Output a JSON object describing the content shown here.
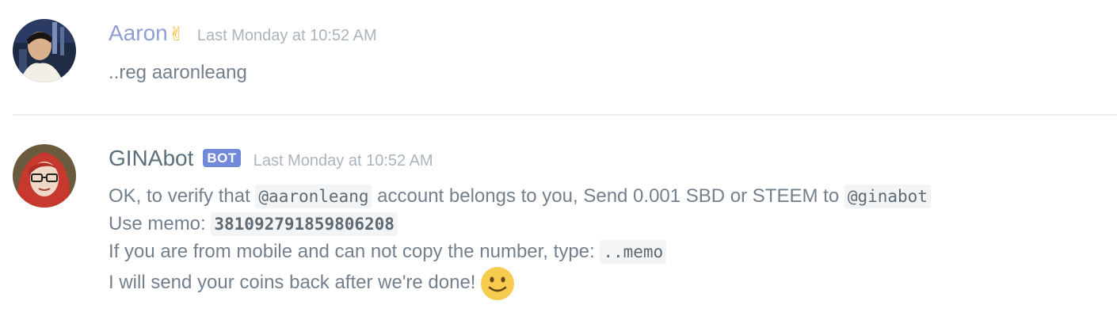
{
  "messages": [
    {
      "username": "Aaron",
      "username_emoji": "✌",
      "timestamp": "Last Monday at 10:52 AM",
      "text": "..reg aaronleang"
    },
    {
      "username": "GINAbot",
      "bot_tag": "BOT",
      "timestamp": "Last Monday at 10:52 AM",
      "lines": [
        {
          "part1": "OK, to verify that ",
          "code1": "@aaronleang",
          "part2": " account belongs to you, Send 0.001 SBD or STEEM to ",
          "code2": "@ginabot"
        },
        {
          "part1": "Use memo: ",
          "code1": "381092791859806208"
        },
        {
          "part1": "If you are from mobile and can not copy the number, type: ",
          "code1": "..memo"
        },
        {
          "part1": "I will send your coins back after we're done!",
          "emoji": "slightly-smiling-face-icon"
        }
      ]
    }
  ],
  "colors": {
    "user_name": "#8f9fd4",
    "bot_name": "#5c6f7d",
    "bot_tag_bg": "#7289da",
    "timestamp": "#aab4bd",
    "message_text": "#737f8d",
    "code_bg": "#f3f4f5",
    "divider": "#ececec"
  }
}
